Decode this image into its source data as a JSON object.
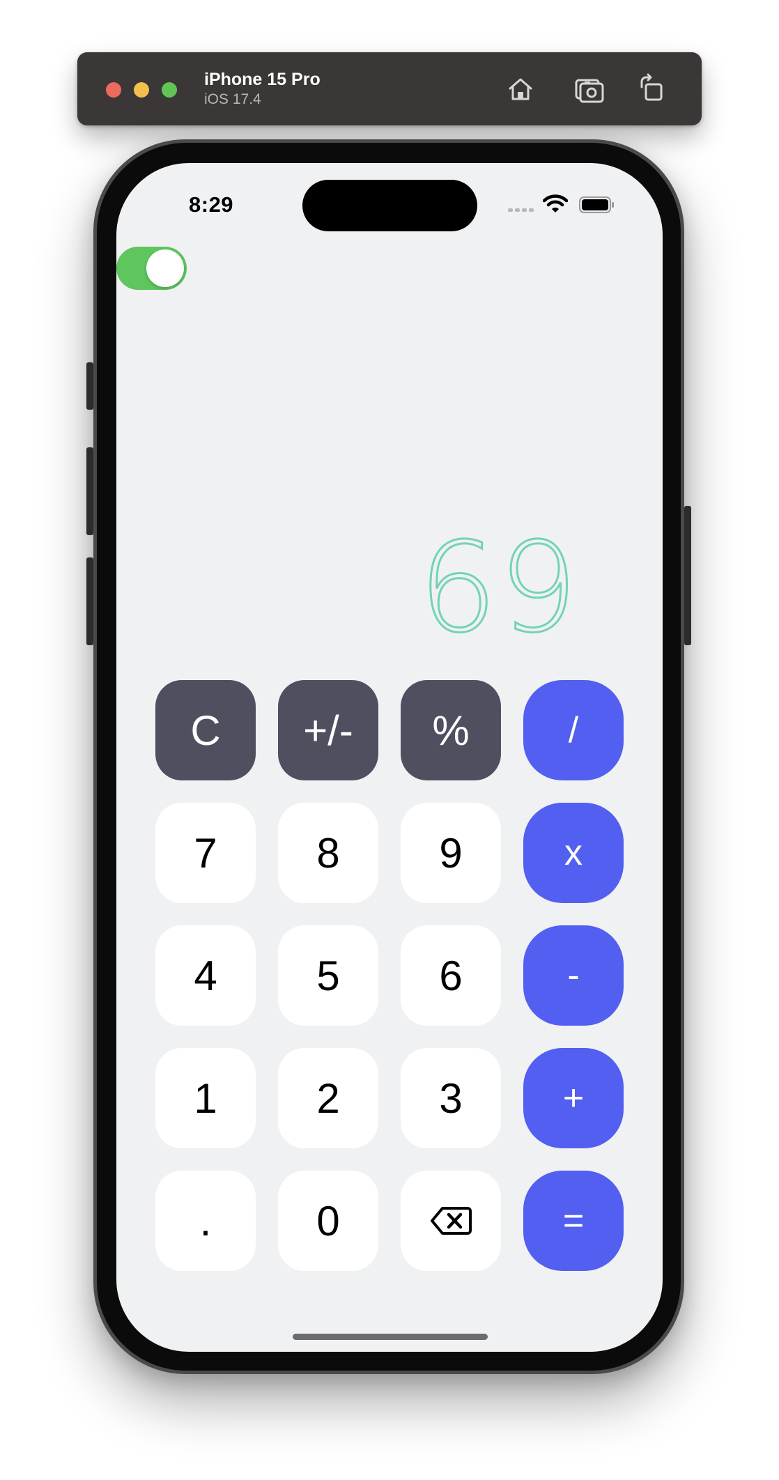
{
  "simulator": {
    "device_name": "iPhone 15 Pro",
    "os_version": "iOS 17.4",
    "toolbar_icons": [
      "home-icon",
      "screenshot-icon",
      "rotate-icon"
    ]
  },
  "status_bar": {
    "time": "8:29",
    "icons": [
      "cellular-signal-icon",
      "wifi-icon",
      "battery-icon"
    ]
  },
  "toggle": {
    "state": "on",
    "color": "#5fc55d"
  },
  "display": {
    "value": "69",
    "color": "#73d3b6"
  },
  "keypad": {
    "rows": [
      [
        {
          "label": "C",
          "kind": "function"
        },
        {
          "label": "+/-",
          "kind": "function"
        },
        {
          "label": "%",
          "kind": "function"
        },
        {
          "label": "/",
          "kind": "operator"
        }
      ],
      [
        {
          "label": "7",
          "kind": "digit"
        },
        {
          "label": "8",
          "kind": "digit"
        },
        {
          "label": "9",
          "kind": "digit"
        },
        {
          "label": "x",
          "kind": "operator"
        }
      ],
      [
        {
          "label": "4",
          "kind": "digit"
        },
        {
          "label": "5",
          "kind": "digit"
        },
        {
          "label": "6",
          "kind": "digit"
        },
        {
          "label": "-",
          "kind": "operator"
        }
      ],
      [
        {
          "label": "1",
          "kind": "digit"
        },
        {
          "label": "2",
          "kind": "digit"
        },
        {
          "label": "3",
          "kind": "digit"
        },
        {
          "label": "+",
          "kind": "operator"
        }
      ],
      [
        {
          "label": ".",
          "kind": "digit"
        },
        {
          "label": "0",
          "kind": "digit"
        },
        {
          "label": "",
          "kind": "digit",
          "icon": "backspace-icon"
        },
        {
          "label": "=",
          "kind": "operator"
        }
      ]
    ]
  },
  "colors": {
    "screen_background": "#f0f1f3",
    "digit_key": "#ffffff",
    "function_key": "#4f4f5f",
    "operator_key": "#535ff0"
  }
}
